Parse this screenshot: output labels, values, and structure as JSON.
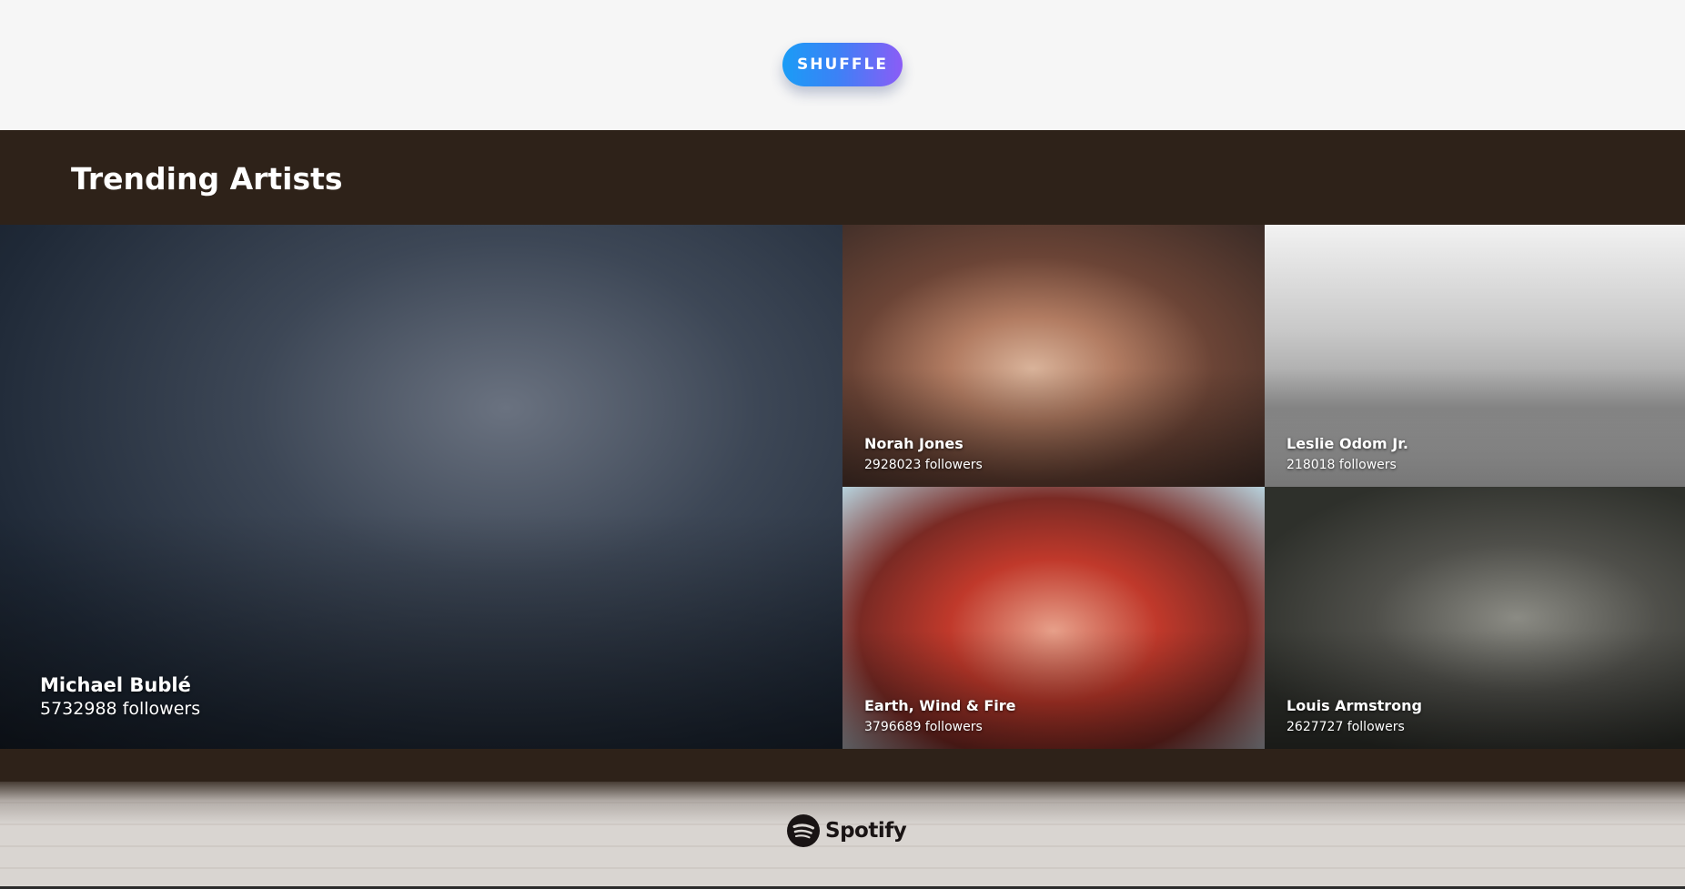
{
  "toolbar": {
    "shuffle_label": "SHUFFLE"
  },
  "trending": {
    "title": "Trending Artists",
    "artists": [
      {
        "name": "Michael Bublé",
        "followers": "5732988 followers"
      },
      {
        "name": "Norah Jones",
        "followers": "2928023 followers"
      },
      {
        "name": "Leslie Odom Jr.",
        "followers": "218018 followers"
      },
      {
        "name": "Earth, Wind & Fire",
        "followers": "3796689 followers"
      },
      {
        "name": "Louis Armstrong",
        "followers": "2627727 followers"
      }
    ]
  },
  "footer": {
    "logo_text": "Spotify",
    "logo_icon": "spotify-icon"
  },
  "colors": {
    "section_bg": "#2e2219",
    "button_gradient_start": "#1a9cf6",
    "button_gradient_end": "#8b5cf6",
    "page_bg": "#f6f6f6"
  }
}
